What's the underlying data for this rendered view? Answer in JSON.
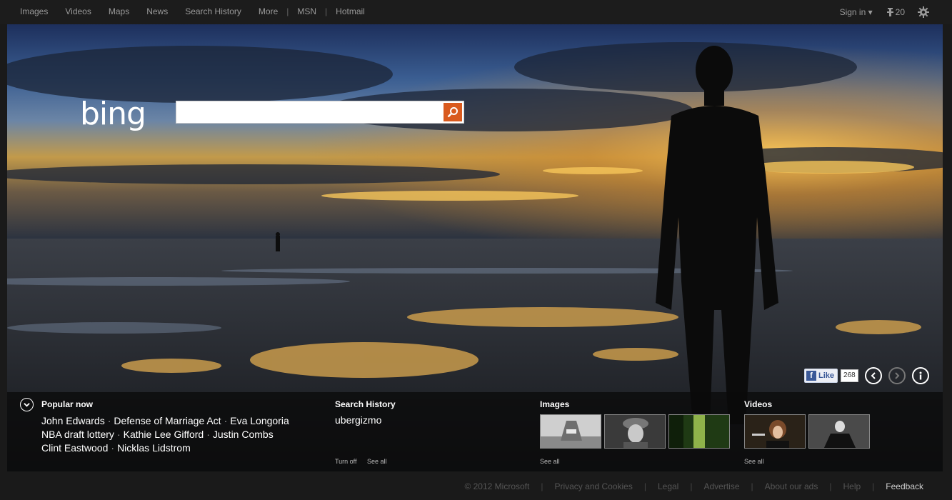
{
  "topnav": {
    "links": [
      "Images",
      "Videos",
      "Maps",
      "News",
      "Search History",
      "More"
    ],
    "links2": [
      "MSN",
      "Hotmail"
    ]
  },
  "topright": {
    "signin": "Sign in",
    "rewards_count": "20"
  },
  "logo": "bing",
  "search": {
    "value": "",
    "placeholder": ""
  },
  "social": {
    "like_label": "Like",
    "like_count": "268"
  },
  "popular": {
    "title": "Popular now",
    "items": [
      "John Edwards",
      "Defense of Marriage Act",
      "Eva Longoria",
      "NBA draft lottery",
      "Kathie Lee Gifford",
      "Justin Combs",
      "Clint Eastwood",
      "Nicklas Lidstrom"
    ]
  },
  "history": {
    "title": "Search History",
    "item": "ubergizmo",
    "turn_off": "Turn off",
    "see_all": "See all"
  },
  "images": {
    "title": "Images",
    "see_all": "See all"
  },
  "videos": {
    "title": "Videos",
    "see_all": "See all"
  },
  "footer": {
    "links": [
      "© 2012 Microsoft",
      "Privacy and Cookies",
      "Legal",
      "Advertise",
      "About our ads",
      "Help",
      "Feedback"
    ]
  },
  "colors": {
    "accent": "#d95a1e",
    "facebook": "#3b5998"
  }
}
